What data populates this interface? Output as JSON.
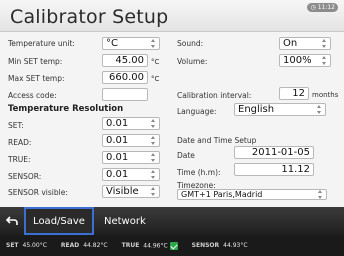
{
  "header": {
    "title": "Calibrator Setup",
    "clock": "11:12"
  },
  "left": {
    "temperature_unit": {
      "label": "Temperature unit:",
      "value": "°C"
    },
    "min_set_temp": {
      "label": "Min SET temp:",
      "value": "45.00",
      "unit": "°C"
    },
    "max_set_temp": {
      "label": "Max SET temp:",
      "value": "660.00",
      "unit": "°C"
    },
    "access_code": {
      "label": "Access code:",
      "value": ""
    },
    "resolution_title": "Temperature Resolution",
    "set": {
      "label": "SET:",
      "value": "0.01"
    },
    "read": {
      "label": "READ:",
      "value": "0.01"
    },
    "true": {
      "label": "TRUE:",
      "value": "0.01"
    },
    "sensor": {
      "label": "SENSOR:",
      "value": "0.01"
    },
    "sensor_visible": {
      "label": "SENSOR visible:",
      "value": "Visible"
    }
  },
  "right": {
    "sound": {
      "label": "Sound:",
      "value": "On"
    },
    "volume": {
      "label": "Volume:",
      "value": "100%"
    },
    "calibration_interval": {
      "label": "Calibration interval:",
      "value": "12",
      "unit": "months"
    },
    "language": {
      "label": "Language:",
      "value": "English"
    },
    "datetime_title": "Date and Time Setup",
    "date": {
      "label": "Date",
      "value": "2011-01-05"
    },
    "time": {
      "label": "Time (h.m):",
      "value": "11.12"
    },
    "timezone": {
      "label": "Timezone:",
      "value": "GMT+1 Paris,Madrid"
    }
  },
  "nav": {
    "load_save": "Load/Save",
    "network": "Network"
  },
  "status": {
    "set_label": "SET",
    "set_value": "45.00°C",
    "read_label": "READ",
    "read_value": "44.82°C",
    "true_label": "TRUE",
    "true_value": "44.96°C",
    "sensor_label": "SENSOR",
    "sensor_value": "44.93°C"
  }
}
